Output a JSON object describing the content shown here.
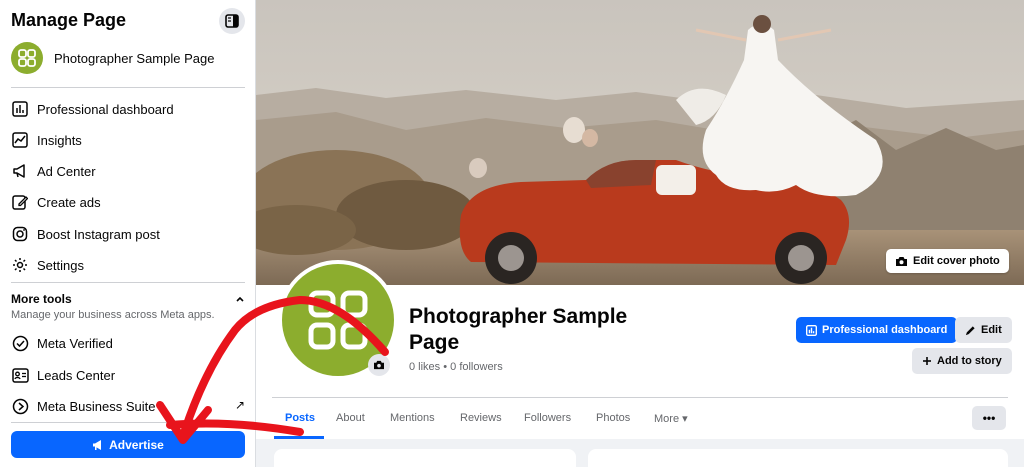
{
  "sidebar": {
    "title": "Manage Page",
    "page_name": "Photographer Sample Page",
    "items": [
      {
        "label": "Professional dashboard",
        "icon": "dashboard-icon"
      },
      {
        "label": "Insights",
        "icon": "insights-icon"
      },
      {
        "label": "Ad Center",
        "icon": "megaphone-icon"
      },
      {
        "label": "Create ads",
        "icon": "edit-icon"
      },
      {
        "label": "Boost Instagram post",
        "icon": "instagram-icon"
      },
      {
        "label": "Settings",
        "icon": "gear-icon"
      }
    ],
    "more_tools": {
      "title": "More tools",
      "subtitle": "Manage your business across Meta apps.",
      "items": [
        {
          "label": "Meta Verified",
          "icon": "verified-icon"
        },
        {
          "label": "Leads Center",
          "icon": "leads-icon"
        },
        {
          "label": "Meta Business Suite",
          "icon": "meta-icon",
          "external": "↗"
        }
      ]
    },
    "advertise_label": "Advertise"
  },
  "cover": {
    "edit_label": "Edit cover photo"
  },
  "profile": {
    "name": "Photographer Sample Page",
    "meta": "0 likes • 0 followers",
    "professional_dashboard_label": "Professional dashboard",
    "edit_label": "Edit",
    "add_story_label": "Add to story"
  },
  "tabs": [
    {
      "label": "Posts"
    },
    {
      "label": "About"
    },
    {
      "label": "Mentions"
    },
    {
      "label": "Reviews"
    },
    {
      "label": "Followers"
    },
    {
      "label": "Photos"
    },
    {
      "label": "More ▾"
    }
  ],
  "more_options_label": "•••",
  "colors": {
    "accent": "#0866ff",
    "avatar": "#8cad2e",
    "annotation_arrow": "#e8141c"
  }
}
